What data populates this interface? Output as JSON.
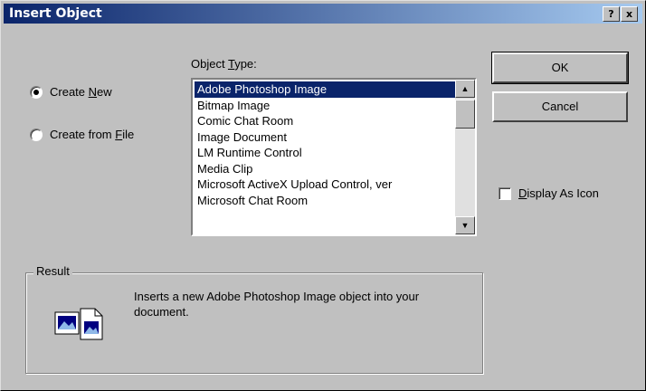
{
  "window": {
    "title": "Insert Object",
    "help_button": "?",
    "close_button": "x"
  },
  "object_type_label_prefix": "Object ",
  "object_type_label_accel": "T",
  "object_type_label_suffix": "ype:",
  "radios": {
    "create_new": {
      "prefix": "Create ",
      "accel": "N",
      "suffix": "ew",
      "selected": true
    },
    "create_from_file": {
      "prefix": "Create from ",
      "accel": "F",
      "suffix": "ile",
      "selected": false
    }
  },
  "object_list": {
    "items": [
      "Adobe Photoshop Image",
      "Bitmap Image",
      "Comic Chat Room",
      "Image Document",
      "LM Runtime Control",
      "Media Clip",
      "Microsoft ActiveX Upload Control, ver",
      "Microsoft Chat Room"
    ],
    "selected_index": 0
  },
  "buttons": {
    "ok": "OK",
    "cancel": "Cancel"
  },
  "display_as_icon": {
    "accel": "D",
    "suffix": "isplay As Icon",
    "checked": false
  },
  "result": {
    "title": "Result",
    "text": "Inserts a new Adobe Photoshop Image object into your document.",
    "icon": "document-image-icon"
  },
  "colors": {
    "titlebar_start": "#0a246a",
    "titlebar_end": "#a6caf0",
    "selection": "#0a246a",
    "face": "#c0c0c0"
  }
}
